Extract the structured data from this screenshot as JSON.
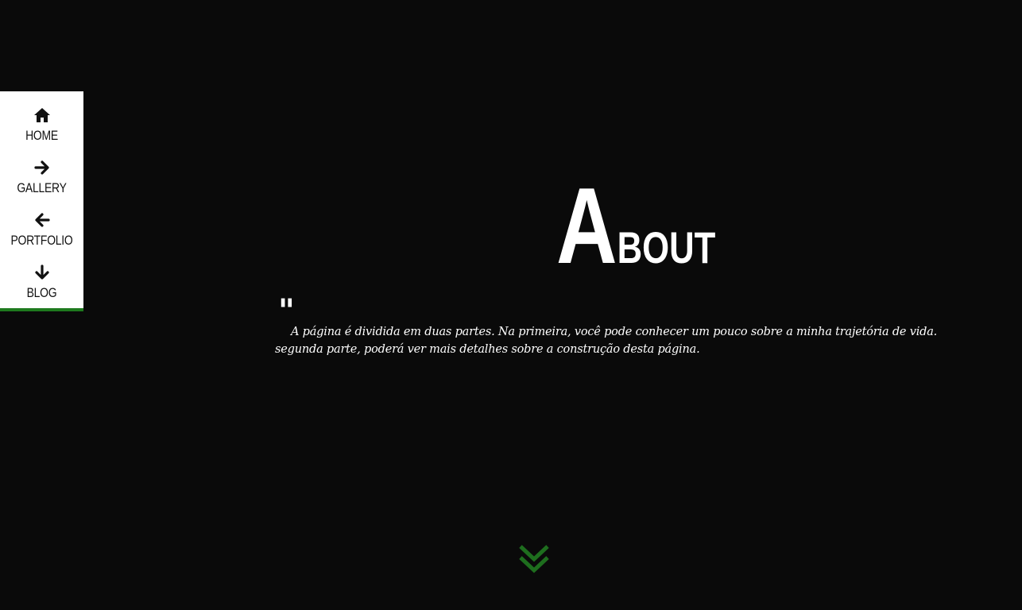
{
  "nav": {
    "items": [
      {
        "label": "HOME",
        "icon": "home-icon"
      },
      {
        "label": "GALLERY",
        "icon": "arrow-right-icon"
      },
      {
        "label": "PORTFOLIO",
        "icon": "arrow-left-icon"
      },
      {
        "label": "BLOG",
        "icon": "arrow-down-icon"
      }
    ],
    "accent_color": "#1e7a1e"
  },
  "section": {
    "title_initial": "A",
    "title_rest": "BOUT",
    "quote_mark": "\"",
    "description_line1": "A página é dividida em duas partes. Na primeira, você pode conhecer um pouco sobre a minha trajetória de vida.",
    "description_line2": "segunda parte, poderá ver mais detalhes sobre a construção desta página."
  },
  "scroll": {
    "icon": "double-chevron-down-icon",
    "color": "#1e7a1e"
  }
}
